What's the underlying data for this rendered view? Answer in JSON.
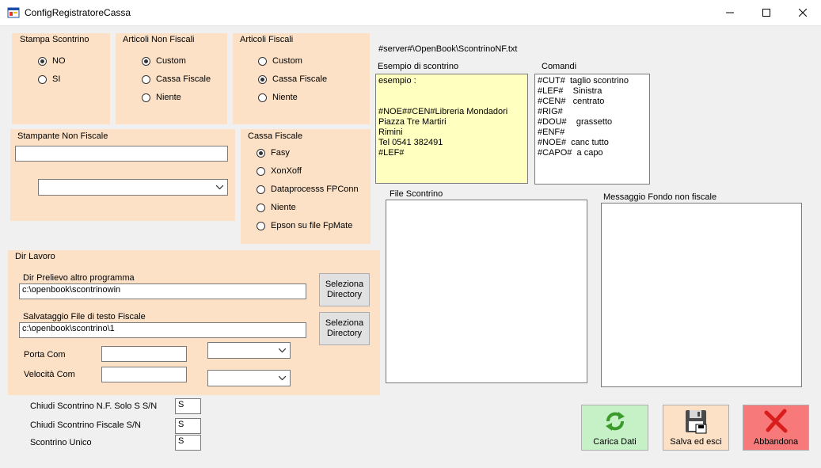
{
  "window": {
    "title": "ConfigRegistratoreCassa"
  },
  "stampa_scontrino": {
    "title": "Stampa Scontrino",
    "options": [
      "NO",
      "SI"
    ],
    "selected": 0
  },
  "articoli_non_fiscali": {
    "title": "Articoli Non Fiscali",
    "options": [
      "Custom",
      "Cassa Fiscale",
      "Niente"
    ],
    "selected": 0
  },
  "articoli_fiscali": {
    "title": "Articoli Fiscali",
    "options": [
      "Custom",
      "Cassa Fiscale",
      "Niente"
    ],
    "selected": 1
  },
  "stampante_non_fiscale": {
    "title": "Stampante Non Fiscale",
    "value": "",
    "combo_value": ""
  },
  "cassa_fiscale": {
    "title": "Cassa Fiscale",
    "options": [
      "Fasy",
      "XonXoff",
      "Dataprocesss FPConn",
      "Niente",
      "Epson su file FpMate"
    ],
    "selected": 0
  },
  "dir_lavoro": {
    "title": "Dir Lavoro",
    "prelievo_label": "Dir Prelievo altro programma",
    "prelievo_value": "c:\\openbook\\scontrinowin",
    "salvataggio_label": "Salvataggio File di testo  Fiscale",
    "salvataggio_value": "c:\\openbook\\scontrino\\1",
    "seleziona_label": "Seleziona\nDirectory",
    "porta_com_label": "Porta Com",
    "porta_com_value": "",
    "velocita_com_label": "Velocità Com",
    "velocita_com_value": ""
  },
  "chiudi": [
    {
      "label": "Chiudi Scontrino N.F. Solo S  S/N",
      "value": "S"
    },
    {
      "label": "Chiudi Scontrino Fiscale  S/N",
      "value": "S"
    },
    {
      "label": "Scontrino Unico",
      "value": "S"
    }
  ],
  "path_label": "#server#\\OpenBook\\ScontrinoNF.txt",
  "esempio": {
    "title": "Esempio di scontrino",
    "text": "esempio :\n\n\n#NOE##CEN#Libreria Mondadori\nPiazza Tre Martiri\nRimini\nTel 0541 382491\n#LEF#"
  },
  "comandi": {
    "title": "Comandi",
    "text": "#CUT#  taglio scontrino\n#LEF#    Sinistra\n#CEN#   centrato\n#RIG#\n#DOU#    grassetto\n#ENF#\n#NOE#  canc tutto\n#CAPO#  a capo"
  },
  "file_scontrino": {
    "title": "File Scontrino"
  },
  "messaggio_fondo": {
    "title": "Messaggio Fondo non fiscale"
  },
  "actions": {
    "carica": {
      "label": "Carica Dati",
      "color": "#c6f1c6",
      "icon": "refresh-icon"
    },
    "salva": {
      "label": "Salva ed esci",
      "color": "#fde1c6",
      "icon": "floppy-save-icon"
    },
    "abbandona": {
      "label": "Abbandona",
      "color": "#f87979",
      "icon": "red-x-icon"
    }
  }
}
